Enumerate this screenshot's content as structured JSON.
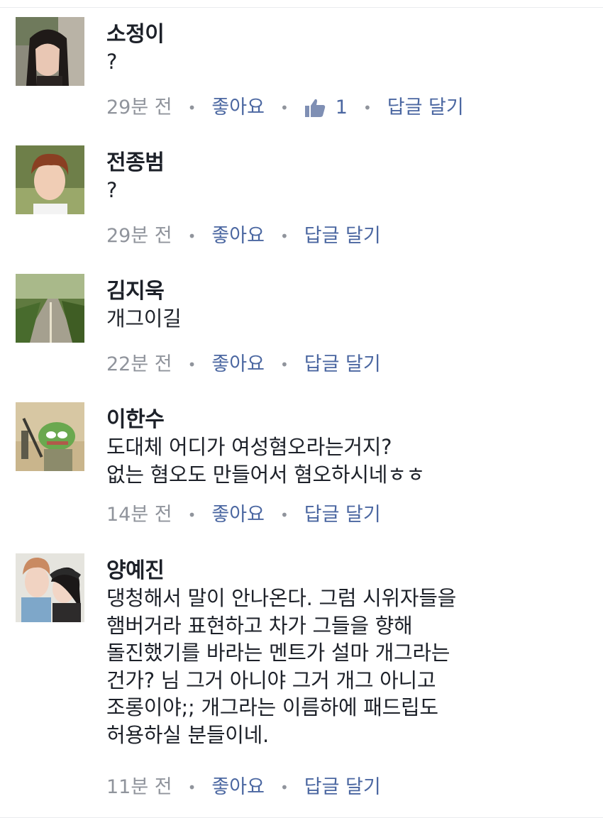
{
  "comments": [
    {
      "name": "소정이",
      "text": "?",
      "time": "29분 전",
      "like_label": "좋아요",
      "like_count": "1",
      "reply_label": "답글 달기"
    },
    {
      "name": "전종범",
      "text": "?",
      "time": "29분 전",
      "like_label": "좋아요",
      "reply_label": "답글 달기"
    },
    {
      "name": "김지욱",
      "text": "개그이길",
      "time": "22분 전",
      "like_label": "좋아요",
      "reply_label": "답글 달기"
    },
    {
      "name": "이한수",
      "text": "도대체 어디가 여성혐오라는거지?\n없는 혐오도 만들어서 혐오하시네ㅎㅎ",
      "time": "14분 전",
      "like_label": "좋아요",
      "reply_label": "답글 달기"
    },
    {
      "name": "양예진",
      "text": "댕청해서 말이 안나온다. 그럼 시위자들을\n햄버거라 표현하고 차가 그들을 향해\n돌진했기를 바라는 멘트가 설마 개그라는\n건가? 님 그거 아니야 그거 개그 아니고\n조롱이야;; 개그라는 이름하에 패드립도\n허용하실 분들이네.",
      "time": "11분 전",
      "like_label": "좋아요",
      "reply_label": "답글 달기"
    }
  ],
  "colors": {
    "name": "#1d2129",
    "meta": "#90949c",
    "action": "#4b67a1"
  },
  "icons": {
    "like": "thumbs-up-icon",
    "separator": "dot-separator"
  }
}
